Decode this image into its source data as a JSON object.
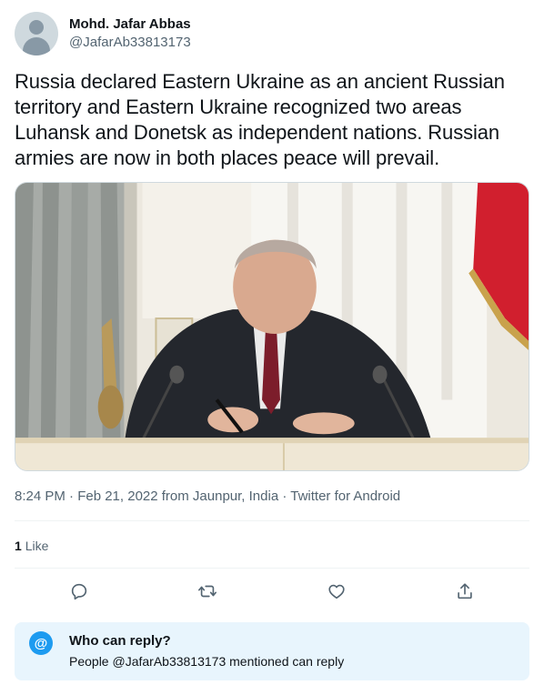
{
  "author": {
    "display_name": "Mohd. Jafar Abbas",
    "handle": "@JafarAb33813173"
  },
  "tweet": {
    "text": "Russia declared Eastern Ukraine as an ancient Russian territory and Eastern Ukraine recognized two areas Luhansk and Donetsk as independent nations. Russian armies are now in both places peace will prevail.",
    "meta": "8:24 PM · Feb 21, 2022 from Jaunpur, India · Twitter for Android"
  },
  "stats": {
    "like_count": "1",
    "like_label": "Like"
  },
  "actions": {
    "icons": [
      "reply-icon",
      "retweet-icon",
      "like-icon",
      "share-icon"
    ]
  },
  "reply_settings": {
    "title": "Who can reply?",
    "subtitle": "People @JafarAb33813173 mentioned can reply",
    "badge": "@"
  },
  "colors": {
    "accent": "#1d9bf0",
    "muted_text": "#536471",
    "reply_box_bg": "#e8f5fd"
  }
}
